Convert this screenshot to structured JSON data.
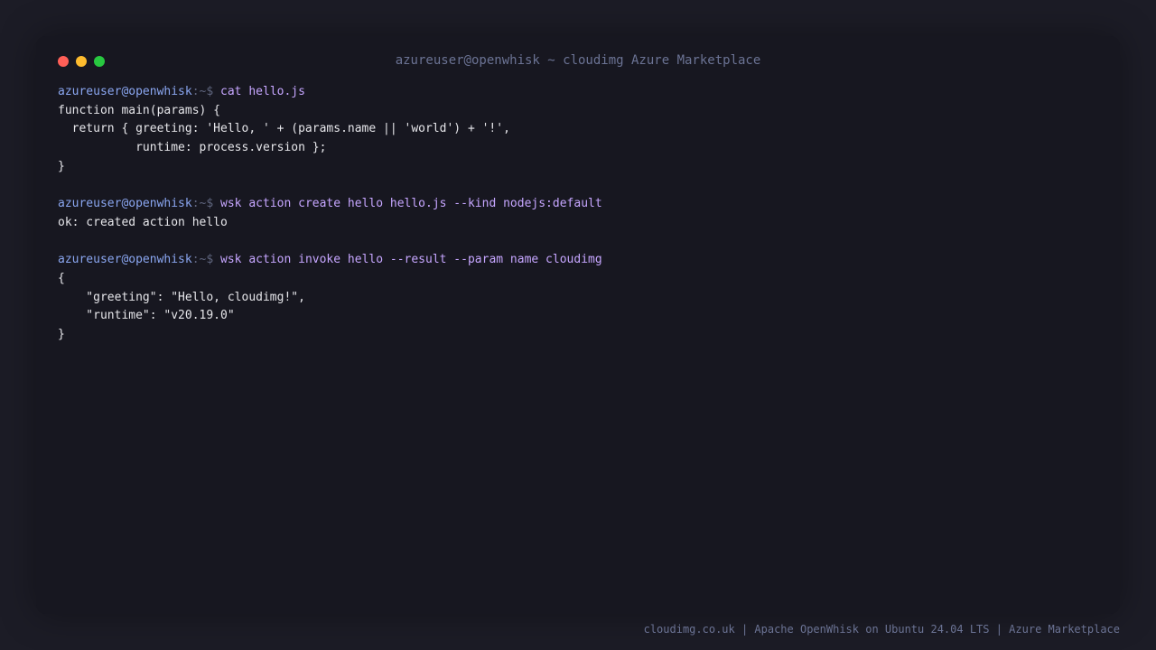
{
  "window": {
    "title": "azureuser@openwhisk ~ cloudimg Azure Marketplace",
    "controls": {
      "close": "close",
      "minimize": "minimize",
      "maximize": "maximize"
    }
  },
  "prompt": {
    "user_host": "azureuser@openwhisk",
    "path_sigil": ":~$"
  },
  "commands": [
    "cat hello.js",
    "wsk action create hello hello.js --kind nodejs:default",
    "wsk action invoke hello --result --param name cloudimg"
  ],
  "outputs": {
    "cat": [
      "function main(params) {",
      "  return { greeting: 'Hello, ' + (params.name || 'world') + '!',",
      "           runtime: process.version };",
      "}"
    ],
    "create": [
      "ok: created action hello"
    ],
    "invoke": [
      "{",
      "    \"greeting\": \"Hello, cloudimg!\",",
      "    \"runtime\": \"v20.19.0\"",
      "}"
    ]
  },
  "footer": "cloudimg.co.uk | Apache OpenWhisk on Ubuntu 24.04 LTS | Azure Marketplace",
  "colors": {
    "background": "#1c1c26",
    "window": "#171720",
    "user": "#8aa6f0",
    "command": "#c6a6ff",
    "output": "#e6e6ea",
    "muted": "#6b7394"
  }
}
